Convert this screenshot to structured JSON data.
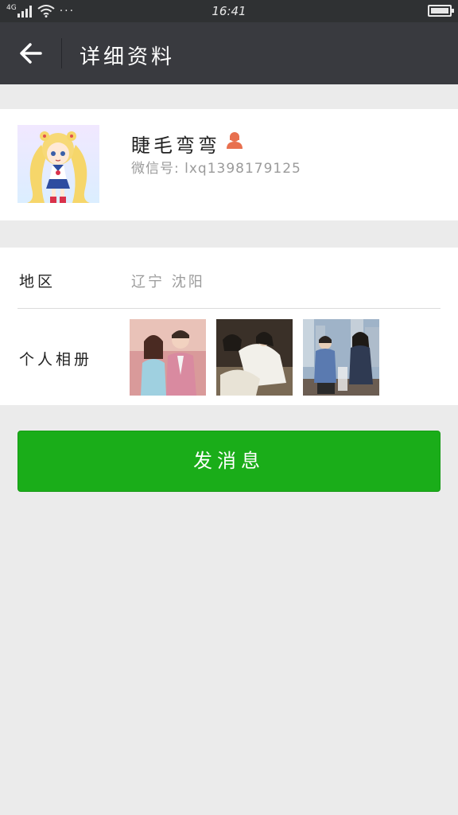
{
  "status_bar": {
    "network": "4G",
    "time": "16:41",
    "more": "···"
  },
  "header": {
    "title": "详细资料"
  },
  "profile": {
    "nickname": "睫毛弯弯",
    "wechat_id": "微信号: lxq1398179125",
    "gender": "female"
  },
  "details": {
    "region_label": "地区",
    "region_value": "辽宁  沈阳",
    "album_label": "个人相册"
  },
  "actions": {
    "send_message": "发消息"
  },
  "colors": {
    "status_bar_bg": "#2f3133",
    "header_bg": "#393a3f",
    "page_bg": "#ebebeb",
    "primary_button": "#1aad19",
    "female_icon": "#e8704f"
  },
  "icons": {
    "back": "arrow-left-icon",
    "gender": "female-user-icon",
    "signal": "signal-icon",
    "wifi": "wifi-icon",
    "battery": "battery-icon"
  }
}
